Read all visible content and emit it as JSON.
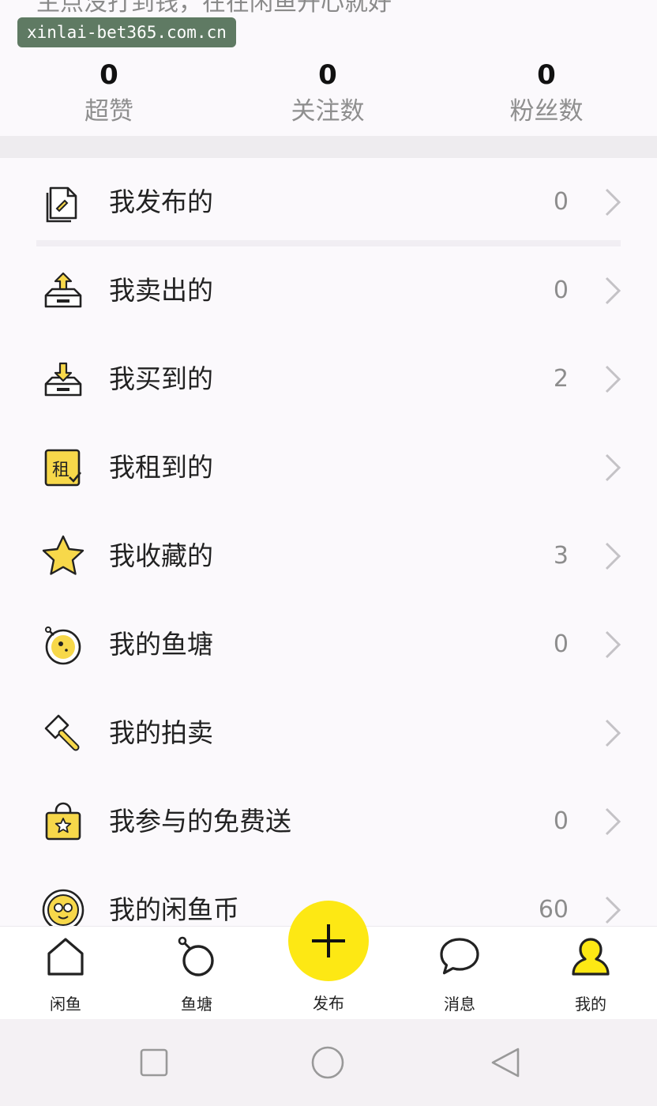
{
  "top_partial_text": "主点没打到钱，在在闲鱼开心就好",
  "watermark": "xinlai-bet365.com.cn",
  "stats": [
    {
      "value": "0",
      "label": "超赞"
    },
    {
      "value": "0",
      "label": "关注数"
    },
    {
      "value": "0",
      "label": "粉丝数"
    }
  ],
  "menu": [
    {
      "label": "我发布的",
      "count": "0",
      "icon": "document-icon"
    },
    {
      "label": "我卖出的",
      "count": "0",
      "icon": "tray-upload-icon"
    },
    {
      "label": "我买到的",
      "count": "2",
      "icon": "tray-download-icon"
    },
    {
      "label": "我租到的",
      "count": "",
      "icon": "rent-badge-icon",
      "icon_text": "租"
    },
    {
      "label": "我收藏的",
      "count": "3",
      "icon": "star-icon"
    },
    {
      "label": "我的鱼塘",
      "count": "0",
      "icon": "fishpond-icon"
    },
    {
      "label": "我的拍卖",
      "count": "",
      "icon": "auction-hammer-icon"
    },
    {
      "label": "我参与的免费送",
      "count": "0",
      "icon": "gift-bag-icon"
    },
    {
      "label": "我的闲鱼币",
      "count": "60",
      "icon": "coin-icon"
    }
  ],
  "tabs": [
    {
      "label": "闲鱼",
      "icon": "home-icon"
    },
    {
      "label": "鱼塘",
      "icon": "pond-ring-icon"
    },
    {
      "label": "发布",
      "icon": "plus-icon"
    },
    {
      "label": "消息",
      "icon": "chat-bubble-icon"
    },
    {
      "label": "我的",
      "icon": "person-icon"
    }
  ],
  "colors": {
    "accent_yellow": "#fde814",
    "icon_yellow": "#f7d84a",
    "text_gray": "#8d8d8d"
  }
}
